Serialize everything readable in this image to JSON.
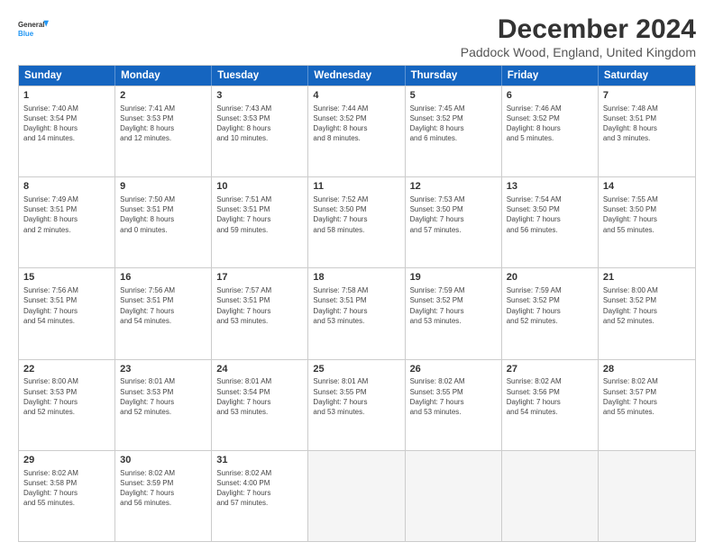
{
  "logo": {
    "line1": "General",
    "line2": "Blue"
  },
  "title": "December 2024",
  "subtitle": "Paddock Wood, England, United Kingdom",
  "header_days": [
    "Sunday",
    "Monday",
    "Tuesday",
    "Wednesday",
    "Thursday",
    "Friday",
    "Saturday"
  ],
  "weeks": [
    [
      {
        "day": "1",
        "lines": [
          "Sunrise: 7:40 AM",
          "Sunset: 3:54 PM",
          "Daylight: 8 hours",
          "and 14 minutes."
        ]
      },
      {
        "day": "2",
        "lines": [
          "Sunrise: 7:41 AM",
          "Sunset: 3:53 PM",
          "Daylight: 8 hours",
          "and 12 minutes."
        ]
      },
      {
        "day": "3",
        "lines": [
          "Sunrise: 7:43 AM",
          "Sunset: 3:53 PM",
          "Daylight: 8 hours",
          "and 10 minutes."
        ]
      },
      {
        "day": "4",
        "lines": [
          "Sunrise: 7:44 AM",
          "Sunset: 3:52 PM",
          "Daylight: 8 hours",
          "and 8 minutes."
        ]
      },
      {
        "day": "5",
        "lines": [
          "Sunrise: 7:45 AM",
          "Sunset: 3:52 PM",
          "Daylight: 8 hours",
          "and 6 minutes."
        ]
      },
      {
        "day": "6",
        "lines": [
          "Sunrise: 7:46 AM",
          "Sunset: 3:52 PM",
          "Daylight: 8 hours",
          "and 5 minutes."
        ]
      },
      {
        "day": "7",
        "lines": [
          "Sunrise: 7:48 AM",
          "Sunset: 3:51 PM",
          "Daylight: 8 hours",
          "and 3 minutes."
        ]
      }
    ],
    [
      {
        "day": "8",
        "lines": [
          "Sunrise: 7:49 AM",
          "Sunset: 3:51 PM",
          "Daylight: 8 hours",
          "and 2 minutes."
        ]
      },
      {
        "day": "9",
        "lines": [
          "Sunrise: 7:50 AM",
          "Sunset: 3:51 PM",
          "Daylight: 8 hours",
          "and 0 minutes."
        ]
      },
      {
        "day": "10",
        "lines": [
          "Sunrise: 7:51 AM",
          "Sunset: 3:51 PM",
          "Daylight: 7 hours",
          "and 59 minutes."
        ]
      },
      {
        "day": "11",
        "lines": [
          "Sunrise: 7:52 AM",
          "Sunset: 3:50 PM",
          "Daylight: 7 hours",
          "and 58 minutes."
        ]
      },
      {
        "day": "12",
        "lines": [
          "Sunrise: 7:53 AM",
          "Sunset: 3:50 PM",
          "Daylight: 7 hours",
          "and 57 minutes."
        ]
      },
      {
        "day": "13",
        "lines": [
          "Sunrise: 7:54 AM",
          "Sunset: 3:50 PM",
          "Daylight: 7 hours",
          "and 56 minutes."
        ]
      },
      {
        "day": "14",
        "lines": [
          "Sunrise: 7:55 AM",
          "Sunset: 3:50 PM",
          "Daylight: 7 hours",
          "and 55 minutes."
        ]
      }
    ],
    [
      {
        "day": "15",
        "lines": [
          "Sunrise: 7:56 AM",
          "Sunset: 3:51 PM",
          "Daylight: 7 hours",
          "and 54 minutes."
        ]
      },
      {
        "day": "16",
        "lines": [
          "Sunrise: 7:56 AM",
          "Sunset: 3:51 PM",
          "Daylight: 7 hours",
          "and 54 minutes."
        ]
      },
      {
        "day": "17",
        "lines": [
          "Sunrise: 7:57 AM",
          "Sunset: 3:51 PM",
          "Daylight: 7 hours",
          "and 53 minutes."
        ]
      },
      {
        "day": "18",
        "lines": [
          "Sunrise: 7:58 AM",
          "Sunset: 3:51 PM",
          "Daylight: 7 hours",
          "and 53 minutes."
        ]
      },
      {
        "day": "19",
        "lines": [
          "Sunrise: 7:59 AM",
          "Sunset: 3:52 PM",
          "Daylight: 7 hours",
          "and 53 minutes."
        ]
      },
      {
        "day": "20",
        "lines": [
          "Sunrise: 7:59 AM",
          "Sunset: 3:52 PM",
          "Daylight: 7 hours",
          "and 52 minutes."
        ]
      },
      {
        "day": "21",
        "lines": [
          "Sunrise: 8:00 AM",
          "Sunset: 3:52 PM",
          "Daylight: 7 hours",
          "and 52 minutes."
        ]
      }
    ],
    [
      {
        "day": "22",
        "lines": [
          "Sunrise: 8:00 AM",
          "Sunset: 3:53 PM",
          "Daylight: 7 hours",
          "and 52 minutes."
        ]
      },
      {
        "day": "23",
        "lines": [
          "Sunrise: 8:01 AM",
          "Sunset: 3:53 PM",
          "Daylight: 7 hours",
          "and 52 minutes."
        ]
      },
      {
        "day": "24",
        "lines": [
          "Sunrise: 8:01 AM",
          "Sunset: 3:54 PM",
          "Daylight: 7 hours",
          "and 53 minutes."
        ]
      },
      {
        "day": "25",
        "lines": [
          "Sunrise: 8:01 AM",
          "Sunset: 3:55 PM",
          "Daylight: 7 hours",
          "and 53 minutes."
        ]
      },
      {
        "day": "26",
        "lines": [
          "Sunrise: 8:02 AM",
          "Sunset: 3:55 PM",
          "Daylight: 7 hours",
          "and 53 minutes."
        ]
      },
      {
        "day": "27",
        "lines": [
          "Sunrise: 8:02 AM",
          "Sunset: 3:56 PM",
          "Daylight: 7 hours",
          "and 54 minutes."
        ]
      },
      {
        "day": "28",
        "lines": [
          "Sunrise: 8:02 AM",
          "Sunset: 3:57 PM",
          "Daylight: 7 hours",
          "and 55 minutes."
        ]
      }
    ],
    [
      {
        "day": "29",
        "lines": [
          "Sunrise: 8:02 AM",
          "Sunset: 3:58 PM",
          "Daylight: 7 hours",
          "and 55 minutes."
        ]
      },
      {
        "day": "30",
        "lines": [
          "Sunrise: 8:02 AM",
          "Sunset: 3:59 PM",
          "Daylight: 7 hours",
          "and 56 minutes."
        ]
      },
      {
        "day": "31",
        "lines": [
          "Sunrise: 8:02 AM",
          "Sunset: 4:00 PM",
          "Daylight: 7 hours",
          "and 57 minutes."
        ]
      },
      {
        "day": "",
        "lines": []
      },
      {
        "day": "",
        "lines": []
      },
      {
        "day": "",
        "lines": []
      },
      {
        "day": "",
        "lines": []
      }
    ]
  ]
}
